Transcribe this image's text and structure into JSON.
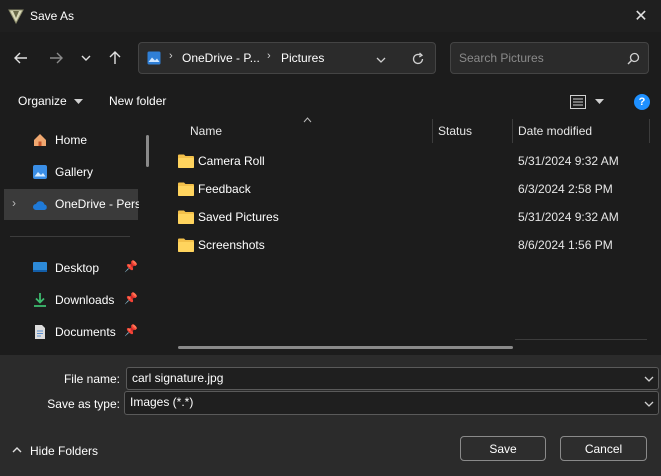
{
  "window": {
    "title": "Save As",
    "close_icon": "close-icon"
  },
  "nav": {
    "breadcrumb": [
      "OneDrive - P...",
      "Pictures"
    ],
    "search_placeholder": "Search Pictures"
  },
  "toolbar": {
    "organize_label": "Organize",
    "new_folder_label": "New folder"
  },
  "sidebar": {
    "items": [
      {
        "label": "Home",
        "icon": "home-icon",
        "pinned": false
      },
      {
        "label": "Gallery",
        "icon": "gallery-icon",
        "pinned": false
      },
      {
        "label": "OneDrive - Perso",
        "icon": "cloud-icon",
        "pinned": false,
        "selected": true
      },
      {
        "label": "Desktop",
        "icon": "desktop-icon",
        "pinned": true
      },
      {
        "label": "Downloads",
        "icon": "downloads-icon",
        "pinned": true
      },
      {
        "label": "Documents",
        "icon": "documents-icon",
        "pinned": true
      }
    ]
  },
  "columns": {
    "name": "Name",
    "status": "Status",
    "date_modified": "Date modified"
  },
  "files": [
    {
      "name": "Camera Roll",
      "date": "5/31/2024 9:32 AM"
    },
    {
      "name": "Feedback",
      "date": "6/3/2024 2:58 PM"
    },
    {
      "name": "Saved Pictures",
      "date": "5/31/2024 9:32 AM"
    },
    {
      "name": "Screenshots",
      "date": "8/6/2024 1:56 PM"
    }
  ],
  "form": {
    "file_name_label": "File name:",
    "file_name_value": "carl signature.jpg",
    "save_type_label": "Save as type:",
    "save_type_value": "Images (*.*)"
  },
  "footer": {
    "hide_folders_label": "Hide Folders",
    "save_label": "Save",
    "cancel_label": "Cancel"
  },
  "colors": {
    "folder": "#f3c04a",
    "accent": "#0078d4",
    "help": "#1e90ff"
  }
}
